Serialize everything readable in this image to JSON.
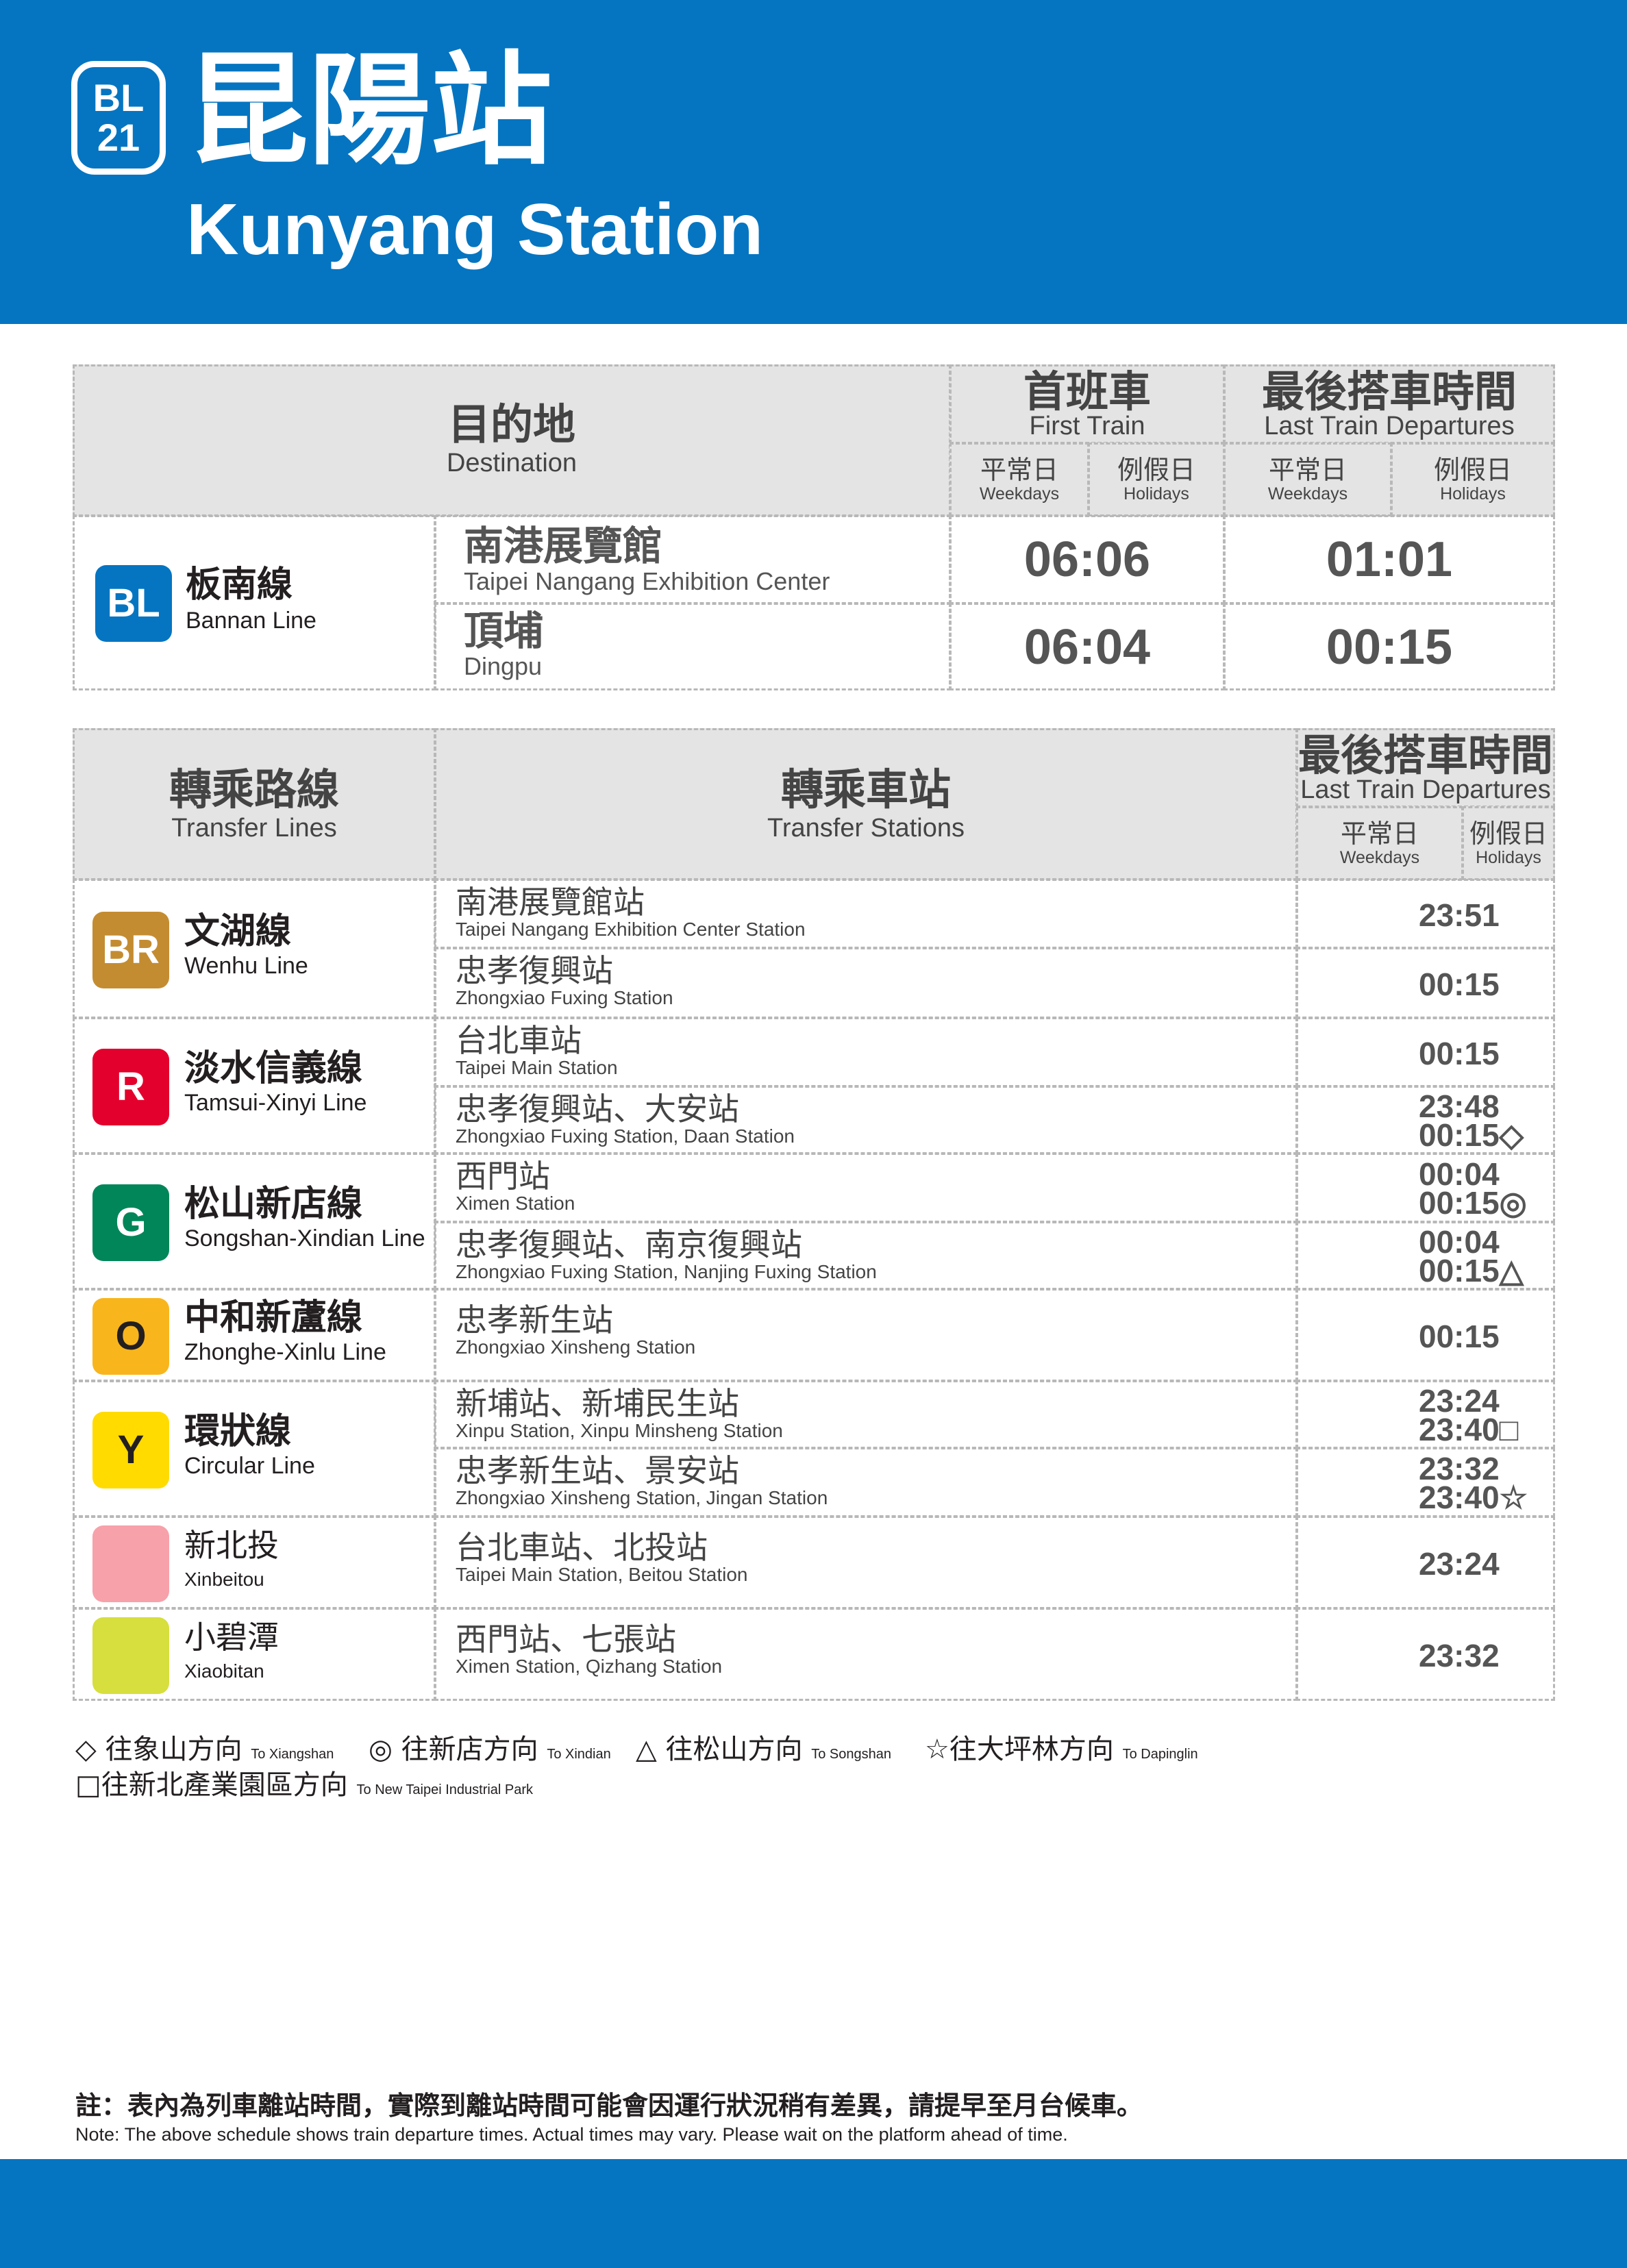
{
  "header": {
    "code_line": "BL",
    "code_num": "21",
    "station_zh": "昆陽站",
    "station_en": "Kunyang Station",
    "color": "#0575c1"
  },
  "first_table": {
    "destination_zh": "目的地",
    "destination_en": "Destination",
    "first_train_zh": "首班車",
    "first_train_en": "First Train",
    "last_train_zh": "最後搭車時間",
    "last_train_en": "Last Train Departures",
    "weekdays_zh": "平常日",
    "weekdays_en": "Weekdays",
    "holidays_zh": "例假日",
    "holidays_en": "Holidays",
    "line": {
      "badge": "BL",
      "name_zh": "板南線",
      "name_en": "Bannan Line",
      "color": "#0575c1"
    },
    "rows": [
      {
        "dest_zh": "南港展覽館",
        "dest_en": "Taipei Nangang Exhibition Center",
        "first": "06:06",
        "last": "01:01"
      },
      {
        "dest_zh": "頂埔",
        "dest_en": "Dingpu",
        "first": "06:04",
        "last": "00:15"
      }
    ]
  },
  "transfer_table": {
    "lines_zh": "轉乘路線",
    "lines_en": "Transfer Lines",
    "stations_zh": "轉乘車站",
    "stations_en": "Transfer Stations",
    "last_train_zh": "最後搭車時間",
    "last_train_en": "Last Train Departures",
    "weekdays_zh": "平常日",
    "weekdays_en": "Weekdays",
    "holidays_zh": "例假日",
    "holidays_en": "Holidays",
    "groups": [
      {
        "badge": "BR",
        "name_zh": "文湖線",
        "name_en": "Wenhu Line",
        "color": "#c48c31",
        "rows": [
          {
            "st_zh": "南港展覽館站",
            "st_en": "Taipei Nangang Exhibition Center Station",
            "time1": "23:51",
            "time2": ""
          },
          {
            "st_zh": "忠孝復興站",
            "st_en": "Zhongxiao Fuxing Station",
            "time1": "00:15",
            "time2": ""
          }
        ]
      },
      {
        "badge": "R",
        "name_zh": "淡水信義線",
        "name_en": "Tamsui-Xinyi Line",
        "color": "#e3002c",
        "rows": [
          {
            "st_zh": "台北車站",
            "st_en": "Taipei Main Station",
            "time1": "00:15",
            "time2": ""
          },
          {
            "st_zh": "忠孝復興站、大安站",
            "st_en": "Zhongxiao Fuxing Station, Daan Station",
            "time1": "23:48",
            "time2": "00:15◇"
          }
        ]
      },
      {
        "badge": "G",
        "name_zh": "松山新店線",
        "name_en": "Songshan-Xindian Line",
        "color": "#008659",
        "rows": [
          {
            "st_zh": "西門站",
            "st_en": "Ximen Station",
            "time1": "00:04",
            "time2": "00:15◎"
          },
          {
            "st_zh": "忠孝復興站、南京復興站",
            "st_en": "Zhongxiao Fuxing Station, Nanjing Fuxing Station",
            "time1": "00:04",
            "time2": "00:15△"
          }
        ]
      },
      {
        "badge": "O",
        "name_zh": "中和新蘆線",
        "name_en": "Zhonghe-Xinlu Line",
        "color": "#f8b61c",
        "rows": [
          {
            "st_zh": "忠孝新生站",
            "st_en": "Zhongxiao Xinsheng Station",
            "time1": "00:15",
            "time2": ""
          }
        ]
      },
      {
        "badge": "Y",
        "name_zh": "環狀線",
        "name_en": "Circular Line",
        "color": "#ffdb00",
        "rows": [
          {
            "st_zh": "新埔站、新埔民生站",
            "st_en": "Xinpu Station, Xinpu Minsheng Station",
            "time1": "23:24",
            "time2": "23:40□"
          },
          {
            "st_zh": "忠孝新生站、景安站",
            "st_en": "Zhongxiao Xinsheng Station, Jingan Station",
            "time1": "23:32",
            "time2": "23:40☆"
          }
        ]
      },
      {
        "badge": "",
        "name_zh": "新北投",
        "name_en": "Xinbeitou",
        "color": "#f7a1aa",
        "rows": [
          {
            "st_zh": "台北車站、北投站",
            "st_en": "Taipei Main Station, Beitou Station",
            "time1": "23:24",
            "time2": ""
          }
        ]
      },
      {
        "badge": "",
        "name_zh": "小碧潭",
        "name_en": "Xiaobitan",
        "color": "#d6df3d",
        "rows": [
          {
            "st_zh": "西門站、七張站",
            "st_en": "Ximen Station, Qizhang Station",
            "time1": "23:32",
            "time2": ""
          }
        ]
      }
    ]
  },
  "legend": [
    {
      "zh": "◇ 往象山方向",
      "en": "To Xiangshan"
    },
    {
      "zh": "◎ 往新店方向",
      "en": "To Xindian"
    },
    {
      "zh": "△ 往松山方向",
      "en": "To Songshan"
    },
    {
      "zh": "☆往大坪林方向",
      "en": "To Dapinglin"
    },
    {
      "zh": "□往新北產業園區方向",
      "en": "To New Taipei Industrial Park"
    }
  ],
  "note": {
    "zh": "註：表內為列車離站時間，實際到離站時間可能會因運行狀況稍有差異，請提早至月台候車。",
    "en": "Note: The above schedule shows train departure times. Actual times may vary. Please wait on the platform ahead of time."
  }
}
